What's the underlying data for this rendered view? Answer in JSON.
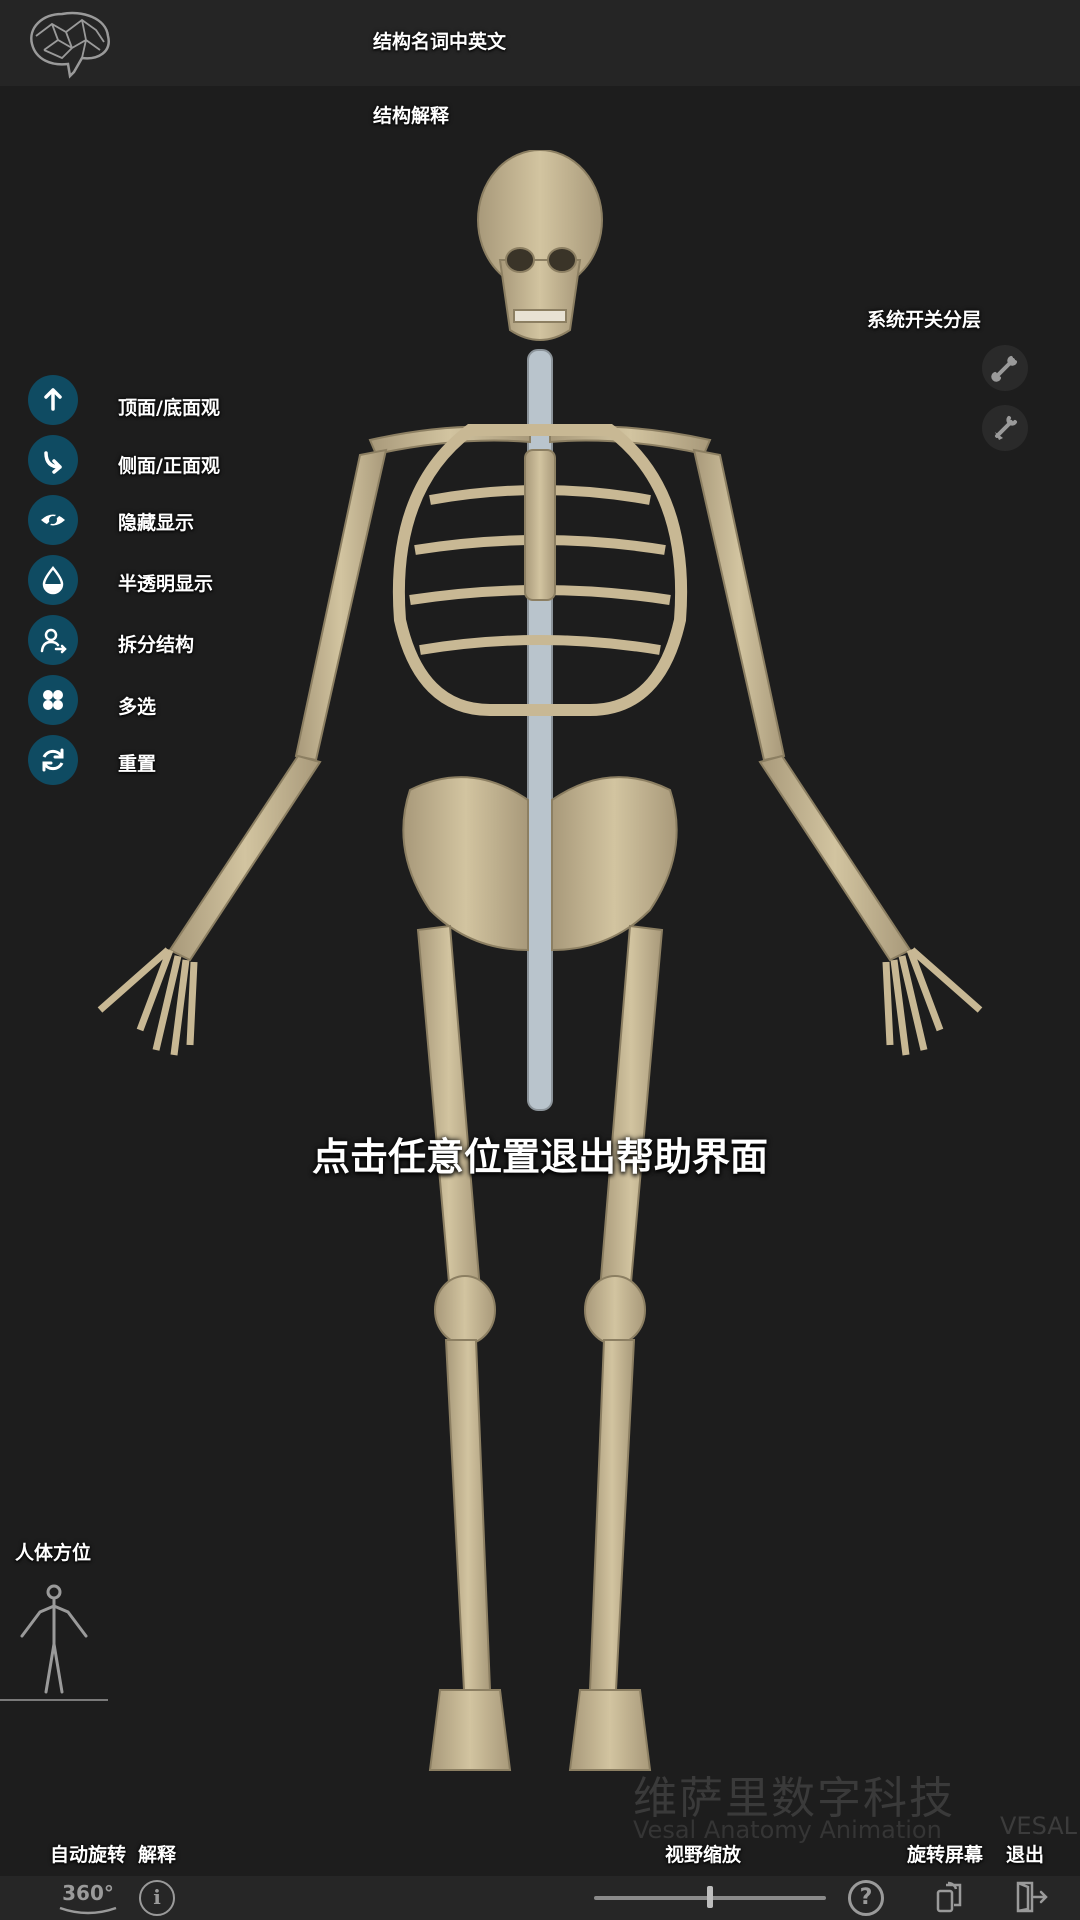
{
  "header": {
    "title": "结构名词中英文",
    "subtitle": "结构解释"
  },
  "right_panel": {
    "title": "系统开关分层",
    "icons": [
      "bone-icon",
      "bone-layer-icon"
    ]
  },
  "toolbar": {
    "items": [
      {
        "label": "顶面/底面观",
        "icon": "flip-up-icon"
      },
      {
        "label": "侧面/正面观",
        "icon": "rotate-side-icon"
      },
      {
        "label": "隐藏显示",
        "icon": "eye-hide-icon"
      },
      {
        "label": "半透明显示",
        "icon": "drop-icon"
      },
      {
        "label": "拆分结构",
        "icon": "user-split-icon"
      },
      {
        "label": "多选",
        "icon": "multi-select-icon"
      },
      {
        "label": "重置",
        "icon": "reset-icon"
      }
    ]
  },
  "help_text": "点击任意位置退出帮助界面",
  "orientation": {
    "label": "人体方位"
  },
  "watermark": {
    "cn": "维萨里数字科技",
    "en": "Vesal Anatomy Animation",
    "logo": "VESAL"
  },
  "bottom": {
    "auto_rotate": "自动旋转",
    "explain": "解释",
    "zoom": "视野缩放",
    "rotate_screen": "旋转屏幕",
    "exit": "退出",
    "rotate_badge": "360°",
    "zoom_level": 0.5
  },
  "colors": {
    "background": "#1d1d1d",
    "topbar": "#252525",
    "tool_button": "#0f4b62",
    "bone": "#c8b894",
    "cartilage": "#b9c4cc"
  }
}
